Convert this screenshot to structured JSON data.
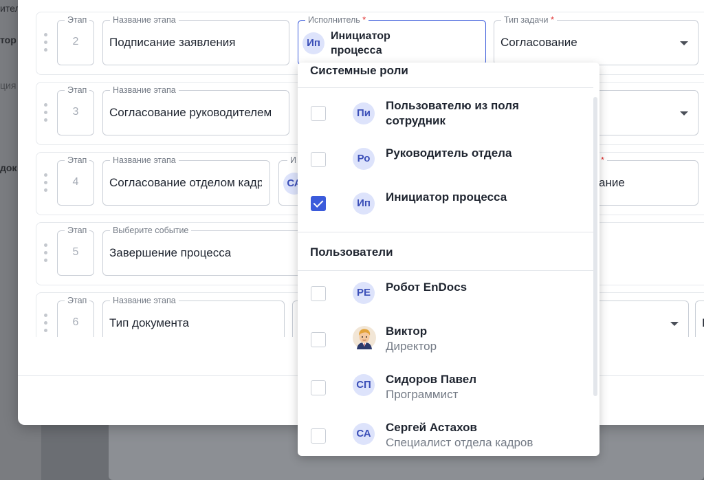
{
  "background": {
    "left_texts": [
      "итель",
      "тор",
      "ция",
      "док"
    ]
  },
  "stages": [
    {
      "stage_label": "Этап",
      "number": "2",
      "name_label": "Название этапа",
      "name_value": "Подписание заявления",
      "executor_label": "Исполнитель",
      "required_mark": "*",
      "executor_chip": "Ип",
      "executor_value_line1": "Инициатор",
      "executor_value_line2": "процесса",
      "task_label": "Тип задачи",
      "task_value": "Согласование"
    },
    {
      "stage_label": "Этап",
      "number": "3",
      "name_label": "Название этапа",
      "name_value": "Согласование руководителем"
    },
    {
      "stage_label": "Этап",
      "number": "4",
      "name_label": "Название этапа",
      "name_value": "Согласование отделом кадров",
      "executor_label_partial": "И",
      "executor_chip": "СА",
      "required_mark": "*",
      "task_value_partial": "ание"
    },
    {
      "stage_label": "Этап",
      "number": "5",
      "name_label": "Выберите событие",
      "name_value": "Завершение процесса"
    },
    {
      "stage_label": "Этап",
      "number": "6",
      "name_label": "Название этапа",
      "name_value": "Тип документа",
      "extra_partial": "Г"
    }
  ],
  "dropdown": {
    "section_roles": "Системные роли",
    "section_users": "Пользователи",
    "roles": [
      {
        "chip": "Пи",
        "title_line1": "Пользователю из поля",
        "title_line2": "сотрудник",
        "checked": false
      },
      {
        "chip": "Ро",
        "title_line1": "Руководитель отдела",
        "checked": false
      },
      {
        "chip": "Ип",
        "title_line1": "Инициатор процесса",
        "checked": true
      }
    ],
    "users": [
      {
        "chip": "РЕ",
        "name": "Робот EnDocs",
        "subtitle": "",
        "checked": false
      },
      {
        "avatar": "avatar-photo-icon",
        "name": "Виктор",
        "subtitle": "Директор",
        "checked": false
      },
      {
        "chip": "СП",
        "name": "Сидоров Павел",
        "subtitle": "Программист",
        "checked": false
      },
      {
        "chip": "СА",
        "name": "Сергей Астахов",
        "subtitle": "Специалист отдела кадров",
        "checked": false
      }
    ]
  },
  "colors": {
    "accent": "#3b5bdb",
    "chip_bg": "#dde3fb",
    "chip_text": "#3b4fb8",
    "required": "#e03131"
  }
}
